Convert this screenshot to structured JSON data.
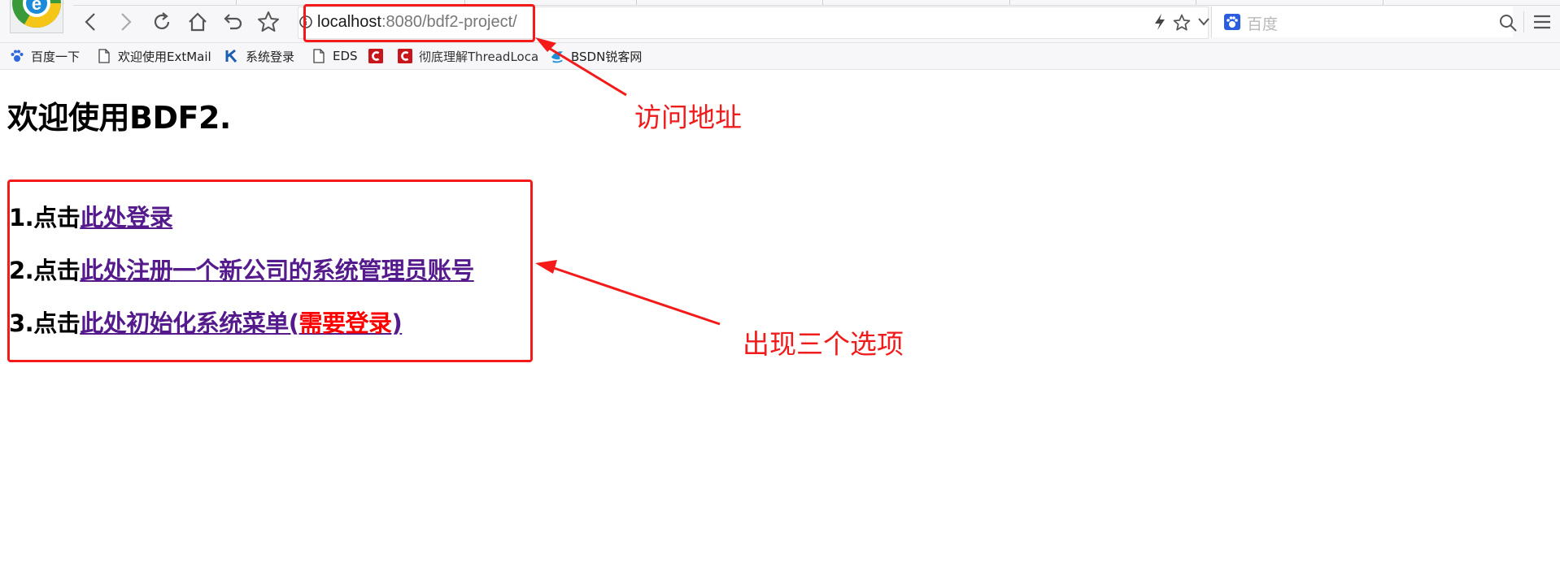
{
  "browser": {
    "url_host": "localhost",
    "url_rest": ":8080/bdf2-project/",
    "search_placeholder": "百度",
    "icons": {
      "back": "back-arrow-icon",
      "forward": "forward-arrow-icon",
      "reload": "reload-icon",
      "home": "home-icon",
      "undo": "undo-icon",
      "star": "star-icon",
      "info": "info-icon",
      "lightning": "lightning-icon",
      "dropdown": "chevron-down-icon",
      "search": "search-icon",
      "menu": "menu-icon"
    }
  },
  "bookmarks": [
    {
      "label": "百度一下",
      "icon": "paw-icon"
    },
    {
      "label": "欢迎使用ExtMail",
      "icon": "page-icon"
    },
    {
      "label": "系统登录",
      "icon": "k-logo-icon"
    },
    {
      "label": "EDS",
      "icon": "page-icon"
    },
    {
      "label": "",
      "icon": "c-logo-icon"
    },
    {
      "label": "彻底理解ThreadLoca",
      "icon": "c-logo-icon"
    },
    {
      "label": "BSDN锐客网",
      "icon": "bird-icon"
    }
  ],
  "page": {
    "title": "欢迎使用BDF2.",
    "options": [
      {
        "prefix": "1.点击",
        "link": "此处登录",
        "link_red": "",
        "link_tail": ""
      },
      {
        "prefix": "2.点击",
        "link": "此处注册一个新公司的系统管理员账号",
        "link_red": "",
        "link_tail": ""
      },
      {
        "prefix": "3.点击",
        "link": "此处初始化系统菜单(",
        "link_red": "需要登录",
        "link_tail": ")"
      }
    ]
  },
  "annotations": {
    "address_note": "访问地址",
    "options_note": "出现三个选项",
    "color": "#f41a1a"
  },
  "colors": {
    "visited_link": "#551a8b",
    "toolbar_bg": "#f7f7f9"
  }
}
